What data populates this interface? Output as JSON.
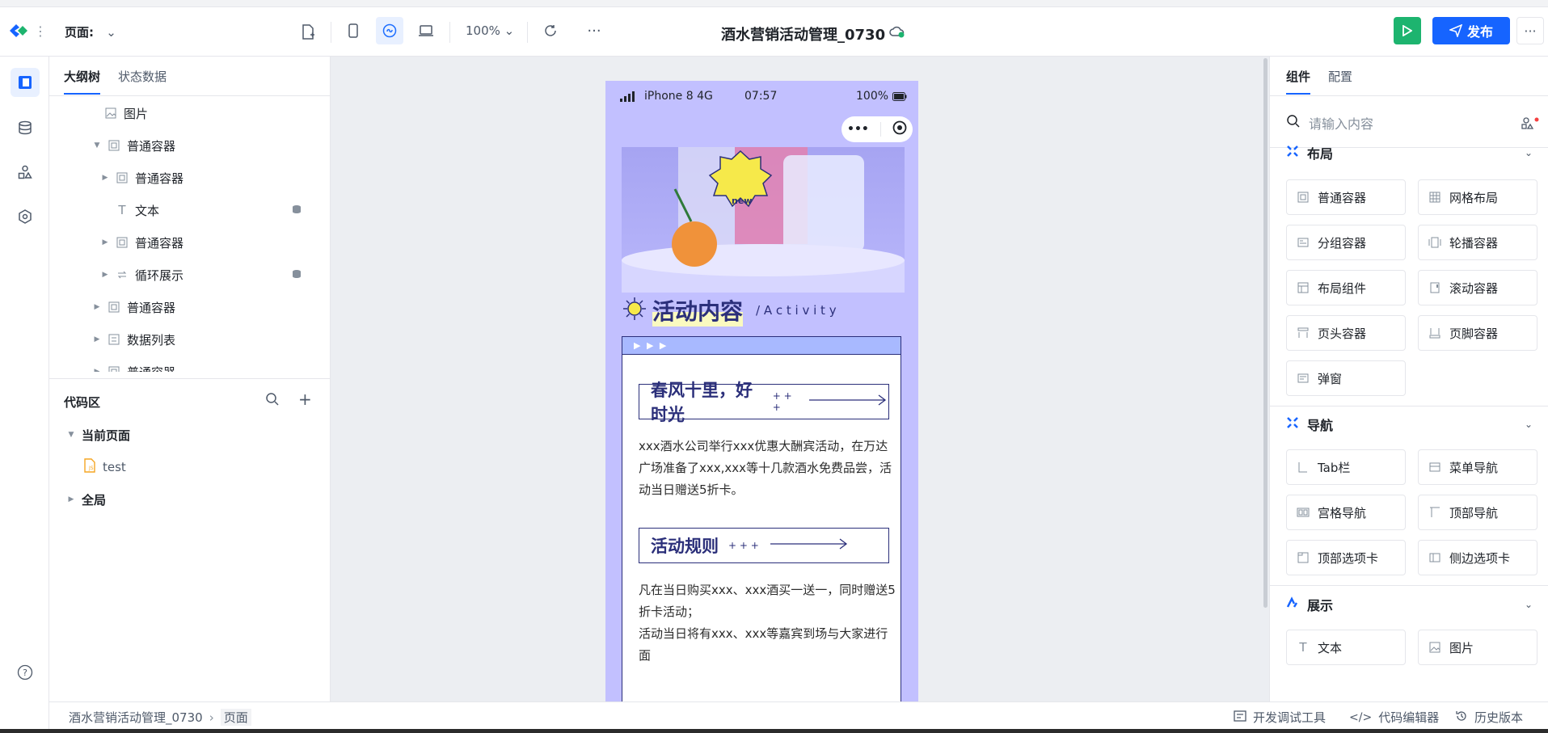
{
  "topbar": {
    "page_label": "页面:",
    "zoom": "100%",
    "title": "酒水营销活动管理_0730",
    "publish_label": "发布"
  },
  "left": {
    "tabs": [
      "大纲树",
      "状态数据"
    ],
    "tree": [
      {
        "label": "图片"
      },
      {
        "label": "普通容器"
      },
      {
        "label": "普通容器"
      },
      {
        "label": "文本"
      },
      {
        "label": "普通容器"
      },
      {
        "label": "循环展示"
      },
      {
        "label": "普通容器"
      },
      {
        "label": "数据列表"
      },
      {
        "label": "普通容器"
      }
    ],
    "code_title": "代码区",
    "code_current": "当前页面",
    "code_file": "test",
    "code_global": "全局"
  },
  "phone": {
    "status_device": "iPhone 8  4G",
    "status_time": "07:57",
    "status_battery": "100%",
    "section_title": "活动内容",
    "section_sub": "/ A c t i v i t y",
    "badge_text": "new",
    "card_top": "▶ ▶ ▶",
    "pill1": "春风十里，好时光",
    "pill_deco": "+ + +",
    "para1": "xxx酒水公司举行xxx优惠大酬宾活动，在万达广场准备了xxx,xxx等十几款酒水免费品尝，活动当日赠送5折卡。",
    "pill2": "活动规则",
    "para2a": "凡在当日购买xxx、xxx酒买一送一，同时赠送5折卡活动；",
    "para2b": "活动当日将有xxx、xxx等嘉宾到场与大家进行面"
  },
  "right": {
    "tabs": [
      "组件",
      "配置"
    ],
    "search_placeholder": "请输入内容",
    "groups": [
      {
        "title": "布局",
        "items": [
          "普通容器",
          "网格布局",
          "分组容器",
          "轮播容器",
          "布局组件",
          "滚动容器",
          "页头容器",
          "页脚容器",
          "弹窗"
        ]
      },
      {
        "title": "导航",
        "items": [
          "Tab栏",
          "菜单导航",
          "宫格导航",
          "顶部导航",
          "顶部选项卡",
          "侧边选项卡"
        ]
      },
      {
        "title": "展示",
        "items": [
          "文本",
          "图片"
        ]
      }
    ]
  },
  "statusbar": {
    "crumb_app": "酒水营销活动管理_0730",
    "crumb_page": "页面",
    "devtools": "开发调试工具",
    "code_editor": "代码编辑器",
    "history": "历史版本"
  },
  "colors": {
    "accent": "#1664ff",
    "run": "#1db46f",
    "phone_bg": "#c2c0ff",
    "ink": "#2b2f7a"
  }
}
